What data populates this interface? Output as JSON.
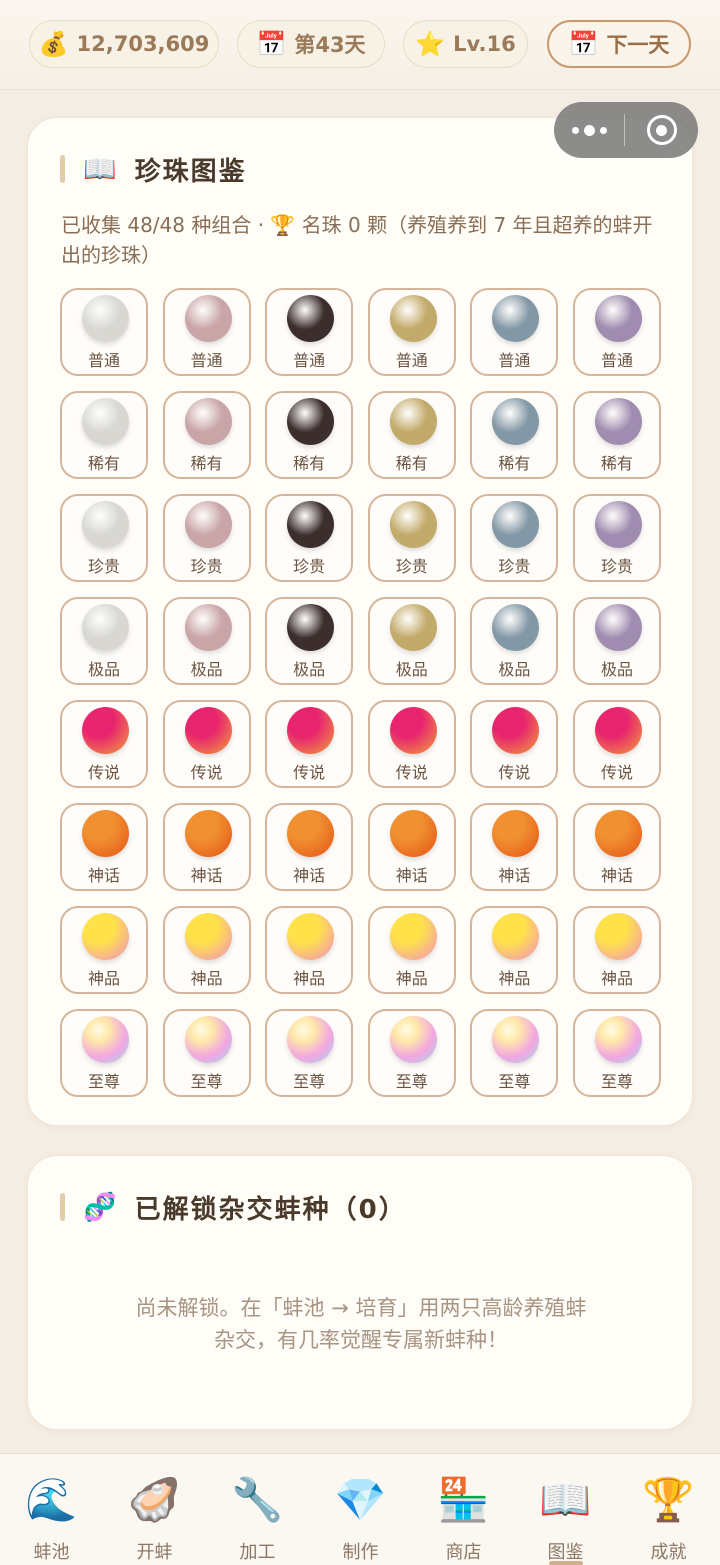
{
  "topbar": {
    "money": {
      "icon": "money-bag-icon",
      "glyph": "💰",
      "value": "12,703,609"
    },
    "day": {
      "icon": "calendar-icon",
      "glyph": "📅",
      "value": "第43天"
    },
    "level": {
      "icon": "star-icon",
      "glyph": "⭐",
      "value": "Lv.16"
    },
    "next_day": {
      "icon": "calendar-icon",
      "glyph": "📅",
      "label": "下一天"
    }
  },
  "pearl_section": {
    "title_icon": "📖",
    "title": "珍珠图鉴",
    "collected_text": "已收集 48/48 种组合 · 🏆 名珠 0 颗（养殖养到 7 年且超养的蚌开出的珍珠）",
    "tiers": [
      {
        "label": "普通"
      },
      {
        "label": "稀有"
      },
      {
        "label": "珍贵"
      },
      {
        "label": "极品"
      },
      {
        "label": "传说"
      },
      {
        "label": "神话"
      },
      {
        "label": "神品"
      },
      {
        "label": "至尊"
      }
    ],
    "base_colors": [
      {
        "name": "white",
        "hex": "#d8d7d2"
      },
      {
        "name": "pink",
        "hex": "#c9a5a7"
      },
      {
        "name": "black",
        "hex": "#3c2e2c"
      },
      {
        "name": "gold",
        "hex": "#c2aa6a"
      },
      {
        "name": "blue-gray",
        "hex": "#8398a6"
      },
      {
        "name": "purple",
        "hex": "#a08cb0"
      }
    ],
    "special_colors": {
      "传说": [
        "#e8246f",
        "#f2a23a"
      ],
      "神话": [
        "#f09030",
        "#e55216"
      ],
      "神品": [
        "#ffe24a",
        "#f08fc3"
      ],
      "至尊": [
        "#ffe9a8",
        "#f2a7e0",
        "#9fd8f0"
      ]
    }
  },
  "hybrid_section": {
    "title_icon": "🧬",
    "title": "已解锁杂交蚌种（0）",
    "message_line1": "尚未解锁。在「蚌池 → 培育」用两只高龄养殖蚌",
    "message_line2": "杂交，有几率觉醒专属新蚌种！"
  },
  "bottom_nav": [
    {
      "icon": "wave-icon",
      "glyph": "🌊",
      "label": "蚌池"
    },
    {
      "icon": "oyster-icon",
      "glyph": "🦪",
      "label": "开蚌"
    },
    {
      "icon": "wrench-icon",
      "glyph": "🔧",
      "label": "加工"
    },
    {
      "icon": "gem-icon",
      "glyph": "💎",
      "label": "制作"
    },
    {
      "icon": "store-icon",
      "glyph": "🏪",
      "label": "商店"
    },
    {
      "icon": "book-icon",
      "glyph": "📖",
      "label": "图鉴",
      "active": true
    },
    {
      "icon": "trophy-icon",
      "glyph": "🏆",
      "label": "成就"
    }
  ]
}
